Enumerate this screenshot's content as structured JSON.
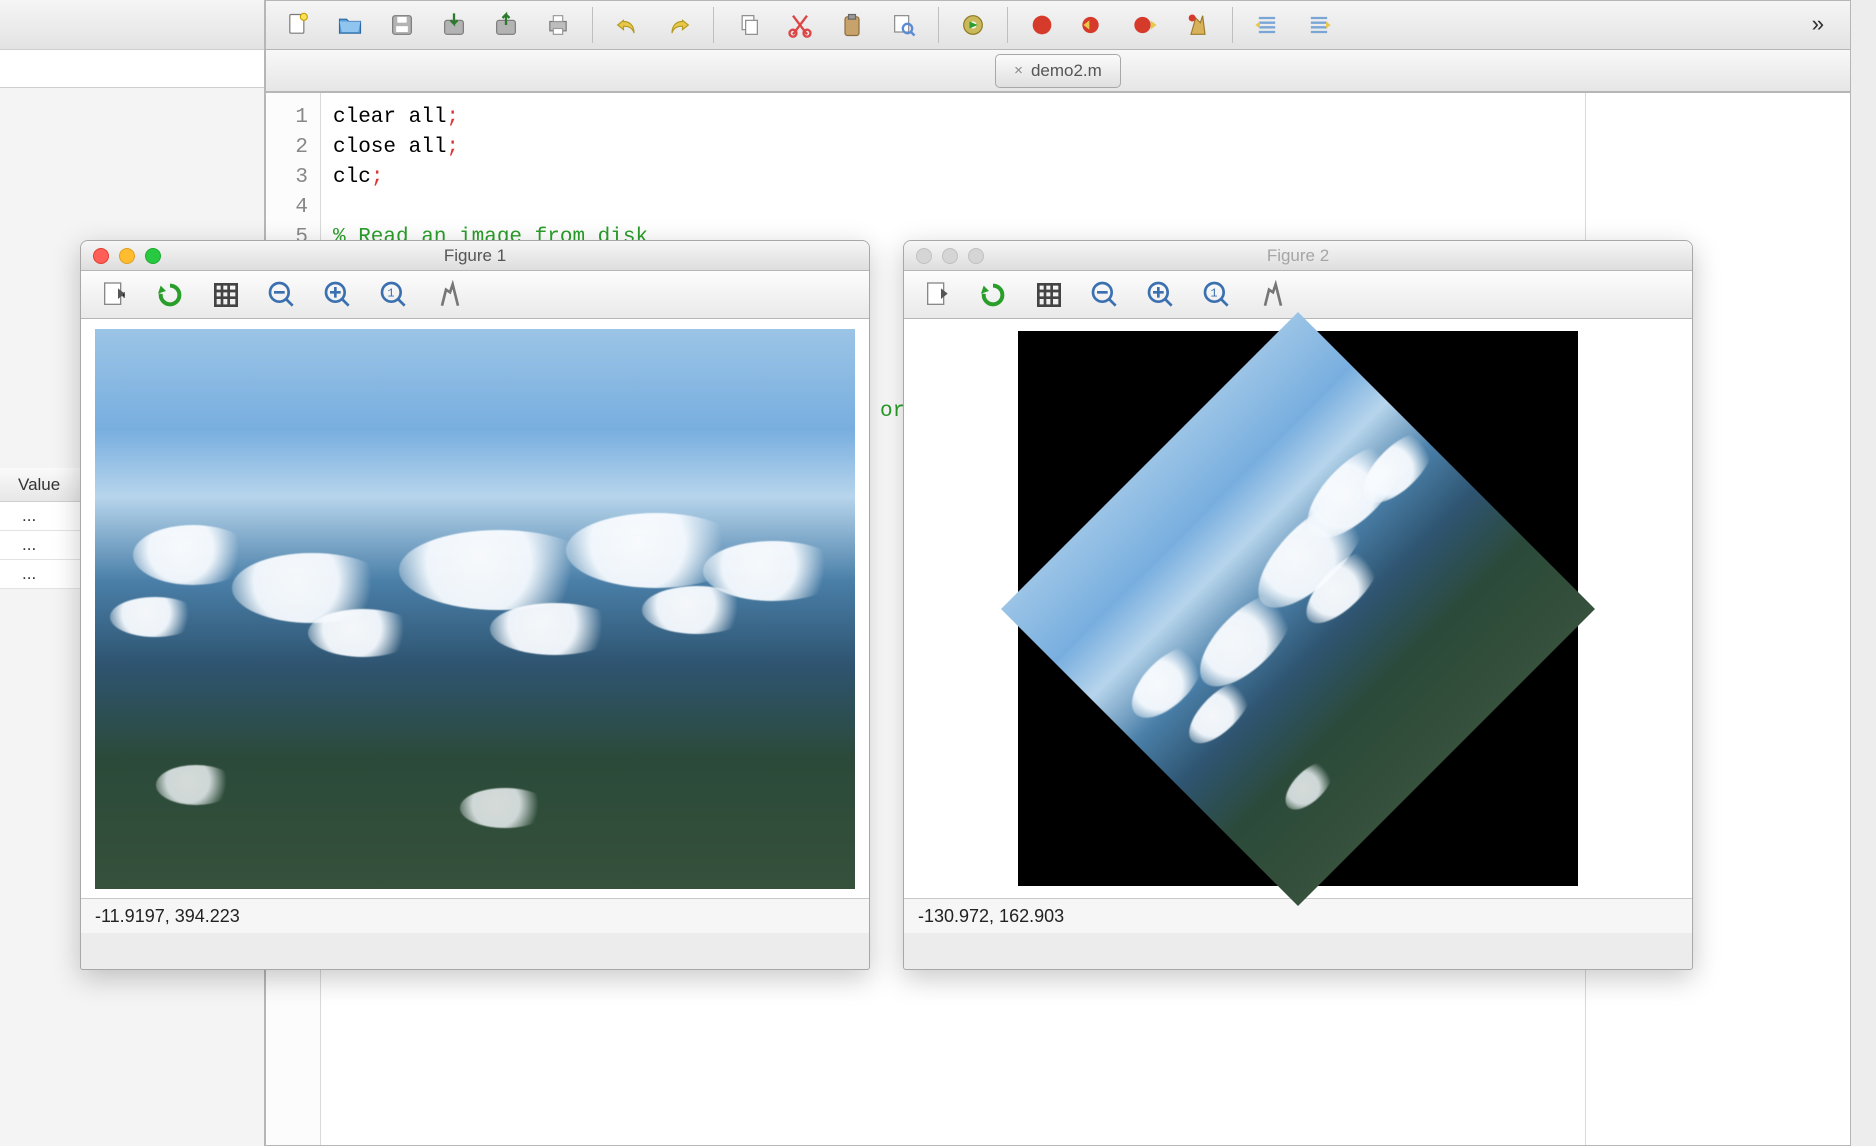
{
  "editor": {
    "tab_filename": "demo2.m",
    "lines": [
      {
        "n": "1",
        "code": "clear all",
        "semi": ";"
      },
      {
        "n": "2",
        "code": "close all",
        "semi": ";"
      },
      {
        "n": "3",
        "code": "clc",
        "semi": ";"
      },
      {
        "n": "4",
        "code": "",
        "semi": ""
      },
      {
        "n": "5",
        "code": "",
        "comment": "% Read an image from disk"
      }
    ],
    "partial_visible_text": "ori"
  },
  "toolbar_icons": [
    "new-file-icon",
    "open-folder-icon",
    "save-icon",
    "save-in-icon",
    "save-out-icon",
    "print-icon",
    "undo-icon",
    "redo-icon",
    "copy-icon",
    "cut-icon",
    "paste-icon",
    "find-icon",
    "run-gear-icon",
    "breakpoint-red-icon",
    "breakpoint-prev-icon",
    "breakpoint-next-icon",
    "breakpoint-clear-icon",
    "indent-left-icon",
    "indent-right-icon",
    "more-icon"
  ],
  "left_panel": {
    "value_header": "Value",
    "rows": [
      "...",
      "...",
      "..."
    ]
  },
  "figure1": {
    "title": "Figure 1",
    "status": "-11.9197, 394.223",
    "toolbar": [
      "pan-icon",
      "rotate-icon",
      "grid-icon",
      "zoom-out-icon",
      "zoom-in-icon",
      "zoom-home-icon",
      "preferences-icon"
    ]
  },
  "figure2": {
    "title": "Figure 2",
    "status": "-130.972, 162.903",
    "toolbar": [
      "pan-icon",
      "rotate-icon",
      "grid-icon",
      "zoom-out-icon",
      "zoom-in-icon",
      "zoom-home-icon",
      "preferences-icon"
    ]
  }
}
